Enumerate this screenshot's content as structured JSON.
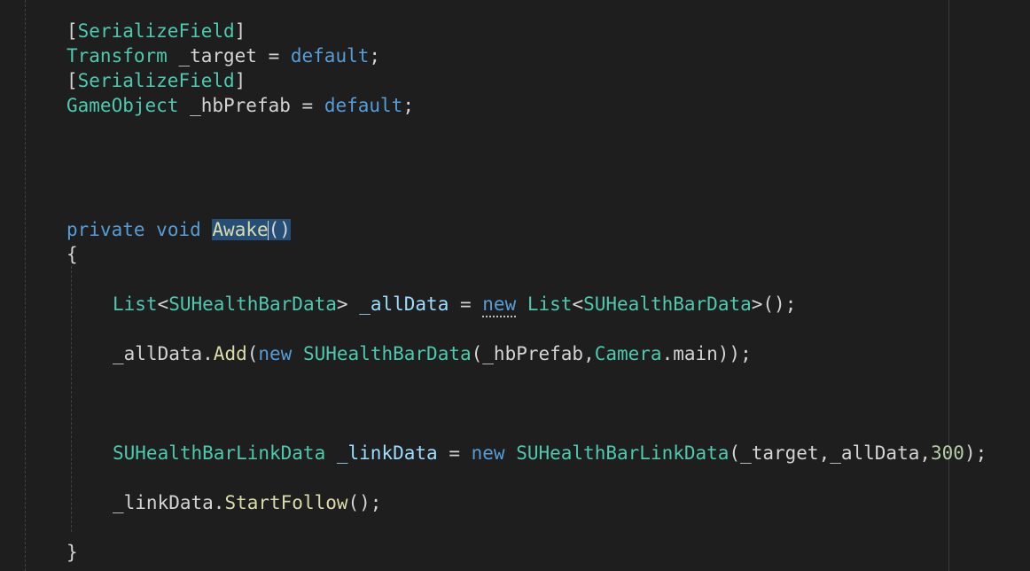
{
  "editor": {
    "theme_colors": {
      "background": "#1e1e1e",
      "keyword": "#569cd6",
      "type": "#4ec9b0",
      "function": "#dcdcaa",
      "variable": "#9cdcfe",
      "number": "#b5cea8",
      "text": "#d4d4d4",
      "selection": "#264f78"
    },
    "lines": [
      {
        "tokens": [
          {
            "t": "[",
            "c": "punc"
          },
          {
            "t": "SerializeField",
            "c": "type"
          },
          {
            "t": "]",
            "c": "punc"
          }
        ]
      },
      {
        "tokens": [
          {
            "t": "Transform",
            "c": "type"
          },
          {
            "t": " _target = ",
            "c": "plain"
          },
          {
            "t": "default",
            "c": "kw"
          },
          {
            "t": ";",
            "c": "punc"
          }
        ]
      },
      {
        "tokens": [
          {
            "t": "[",
            "c": "punc"
          },
          {
            "t": "SerializeField",
            "c": "type"
          },
          {
            "t": "]",
            "c": "punc"
          }
        ]
      },
      {
        "tokens": [
          {
            "t": "GameObject",
            "c": "type"
          },
          {
            "t": " _hbPrefab = ",
            "c": "plain"
          },
          {
            "t": "default",
            "c": "kw"
          },
          {
            "t": ";",
            "c": "punc"
          }
        ]
      },
      {
        "tokens": [
          {
            "t": "private",
            "c": "kw"
          },
          {
            "t": " ",
            "c": "plain"
          },
          {
            "t": "void",
            "c": "kw"
          },
          {
            "t": " ",
            "c": "plain"
          },
          {
            "t": "Awake",
            "c": "fn hl"
          },
          {
            "t": "()",
            "c": "punc hl"
          }
        ]
      },
      {
        "tokens": [
          {
            "t": "{",
            "c": "punc"
          }
        ]
      },
      {
        "tokens": [
          {
            "t": "List",
            "c": "type"
          },
          {
            "t": "<",
            "c": "punc"
          },
          {
            "t": "SUHealthBarData",
            "c": "type"
          },
          {
            "t": "> ",
            "c": "punc"
          },
          {
            "t": "_allData",
            "c": "var"
          },
          {
            "t": " = ",
            "c": "plain"
          },
          {
            "t": "new",
            "c": "kw dots"
          },
          {
            "t": " ",
            "c": "plain"
          },
          {
            "t": "List",
            "c": "type"
          },
          {
            "t": "<",
            "c": "punc"
          },
          {
            "t": "SUHealthBarData",
            "c": "type"
          },
          {
            "t": ">();",
            "c": "punc"
          }
        ]
      },
      {
        "tokens": [
          {
            "t": "_allData.",
            "c": "plain"
          },
          {
            "t": "Add",
            "c": "fn"
          },
          {
            "t": "(",
            "c": "punc"
          },
          {
            "t": "new",
            "c": "kw"
          },
          {
            "t": " ",
            "c": "plain"
          },
          {
            "t": "SUHealthBarData",
            "c": "type"
          },
          {
            "t": "(_hbPrefab,",
            "c": "plain"
          },
          {
            "t": "Camera",
            "c": "type"
          },
          {
            "t": ".main));",
            "c": "plain"
          }
        ]
      },
      {
        "tokens": [
          {
            "t": "SUHealthBarLinkData",
            "c": "type"
          },
          {
            "t": " ",
            "c": "plain"
          },
          {
            "t": "_linkData",
            "c": "var"
          },
          {
            "t": " = ",
            "c": "plain"
          },
          {
            "t": "new",
            "c": "kw"
          },
          {
            "t": " ",
            "c": "plain"
          },
          {
            "t": "SUHealthBarLinkData",
            "c": "type"
          },
          {
            "t": "(_target,_allData,",
            "c": "plain"
          },
          {
            "t": "300",
            "c": "num"
          },
          {
            "t": ");",
            "c": "punc"
          }
        ]
      },
      {
        "tokens": [
          {
            "t": "_linkData.",
            "c": "plain"
          },
          {
            "t": "StartFollow",
            "c": "fn"
          },
          {
            "t": "();",
            "c": "punc"
          }
        ]
      },
      {
        "tokens": [
          {
            "t": "}",
            "c": "punc"
          }
        ]
      }
    ]
  }
}
